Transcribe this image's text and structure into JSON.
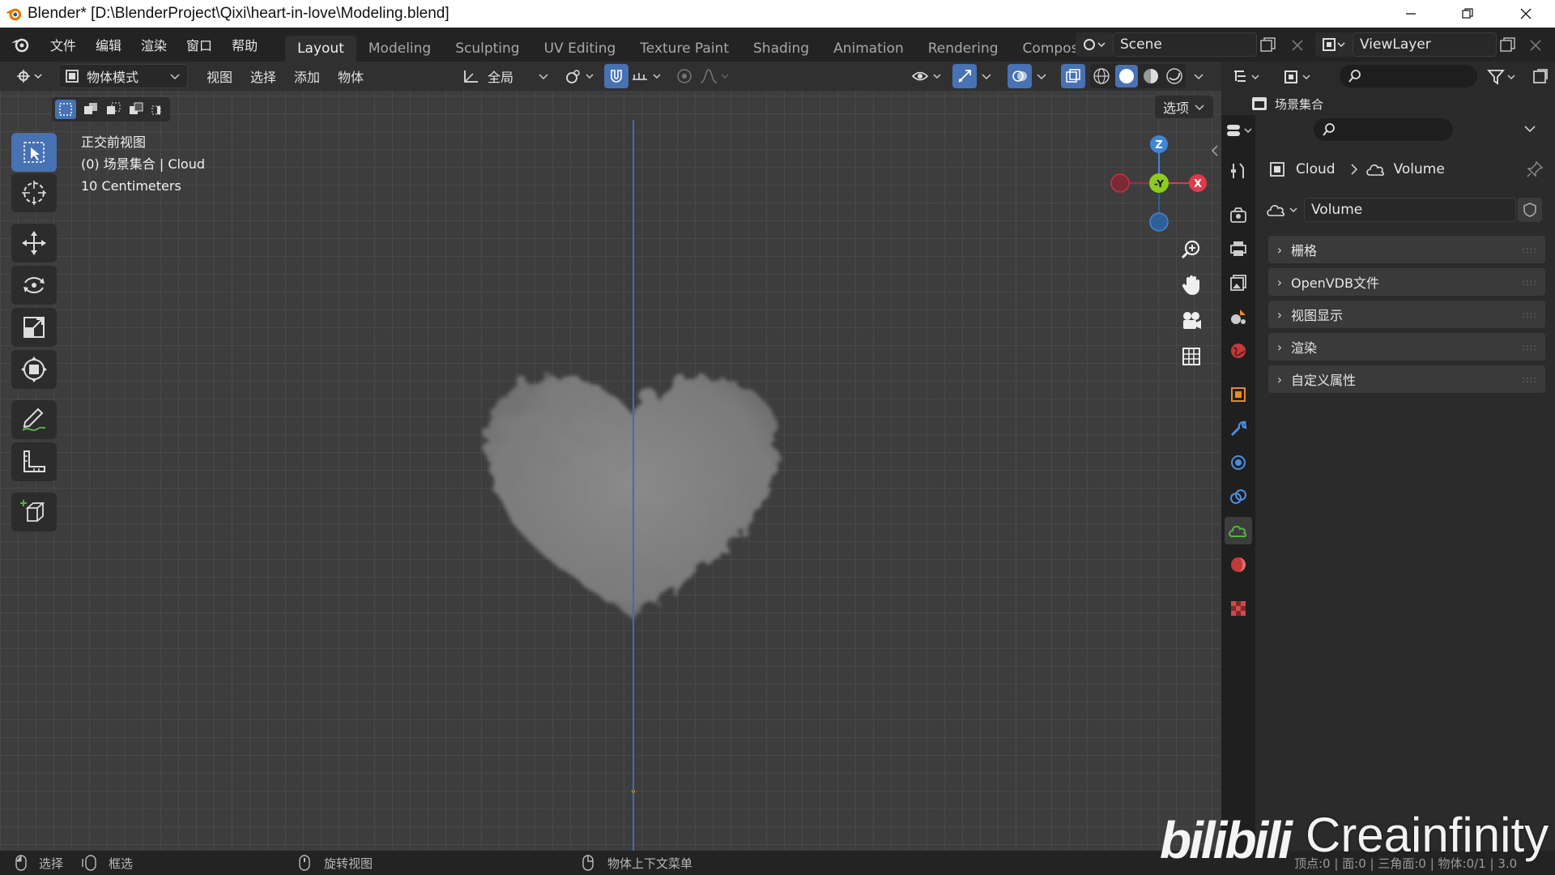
{
  "window": {
    "title": "Blender* [D:\\BlenderProject\\Qixi\\heart-in-love\\Modeling.blend]"
  },
  "menu": [
    "文件",
    "编辑",
    "渲染",
    "窗口",
    "帮助"
  ],
  "workspaces": [
    {
      "label": "Layout",
      "active": true
    },
    {
      "label": "Modeling"
    },
    {
      "label": "Sculpting"
    },
    {
      "label": "UV Editing"
    },
    {
      "label": "Texture Paint"
    },
    {
      "label": "Shading"
    },
    {
      "label": "Animation"
    },
    {
      "label": "Rendering"
    },
    {
      "label": "Compositing"
    }
  ],
  "scene": {
    "name": "Scene",
    "viewlayer": "ViewLayer"
  },
  "viewport_header": {
    "mode": "物体模式",
    "menus": [
      "视图",
      "选择",
      "添加",
      "物体"
    ],
    "transform_orientation": "全局",
    "options_label": "选项"
  },
  "viewport": {
    "view_name": "正交前视图",
    "collection_object": "(0) 场景集合 | Cloud",
    "scale": "10 Centimeters",
    "gizmo_axes": {
      "z": "Z",
      "y": "-Y",
      "x": "X"
    }
  },
  "outliner": {
    "collection": "场景集合"
  },
  "properties": {
    "breadcrumb": {
      "object": "Cloud",
      "data": "Volume"
    },
    "datablock": "Volume",
    "panels": [
      "栅格",
      "OpenVDB文件",
      "视图显示",
      "渲染",
      "自定义属性"
    ]
  },
  "statusbar": {
    "select": "选择",
    "box_select": "框选",
    "rotate_view": "旋转视图",
    "context_menu": "物体上下文菜单",
    "stats": "顶点:0 | 面:0 | 三角面:0 | 物体:0/1 | 3.0"
  },
  "watermark": {
    "left": "bilibili",
    "right": "Creainfinity"
  },
  "colors": {
    "accent": "#4772b3",
    "x_axis": "#e2394b",
    "y_axis": "#8ccc1f",
    "z_axis": "#3e86d8"
  }
}
